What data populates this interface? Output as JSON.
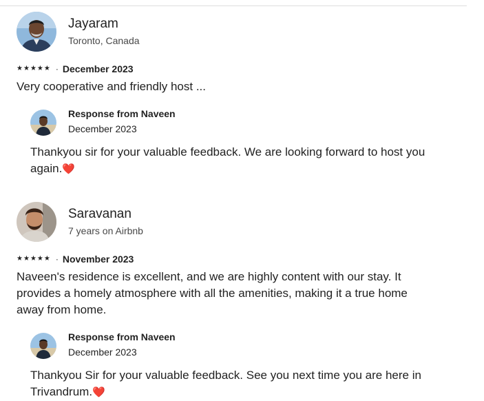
{
  "reviews": [
    {
      "reviewer_name": "Jayaram",
      "reviewer_meta": "Toronto, Canada",
      "stars": 5,
      "star_glyph": "★",
      "separator": "·",
      "date": "December 2023",
      "text": "Very cooperative and friendly  host ...",
      "avatar_icon": "user-photo-icon",
      "response": {
        "title": "Response from Naveen",
        "date": "December 2023",
        "text": "Thankyou sir for your valuable feedback. We are looking forward to host you again.",
        "emoji": "❤️",
        "avatar_icon": "host-photo-icon"
      }
    },
    {
      "reviewer_name": "Saravanan",
      "reviewer_meta": "7 years on Airbnb",
      "stars": 5,
      "star_glyph": "★",
      "separator": "·",
      "date": "November 2023",
      "text": "Naveen's residence is excellent, and we are highly content with our stay. It provides a homely atmosphere with all the amenities, making it a true home away from home.",
      "avatar_icon": "user-photo-icon",
      "response": {
        "title": "Response from Naveen",
        "date": "December 2023",
        "text": "Thankyou Sir for your valuable feedback. See you next time you are here in Trivandrum.",
        "emoji": "❤️",
        "avatar_icon": "host-photo-icon"
      }
    }
  ],
  "colors": {
    "text": "#222222",
    "muted": "#484848",
    "divider": "#dddddd",
    "heart": "#e31c3d"
  }
}
